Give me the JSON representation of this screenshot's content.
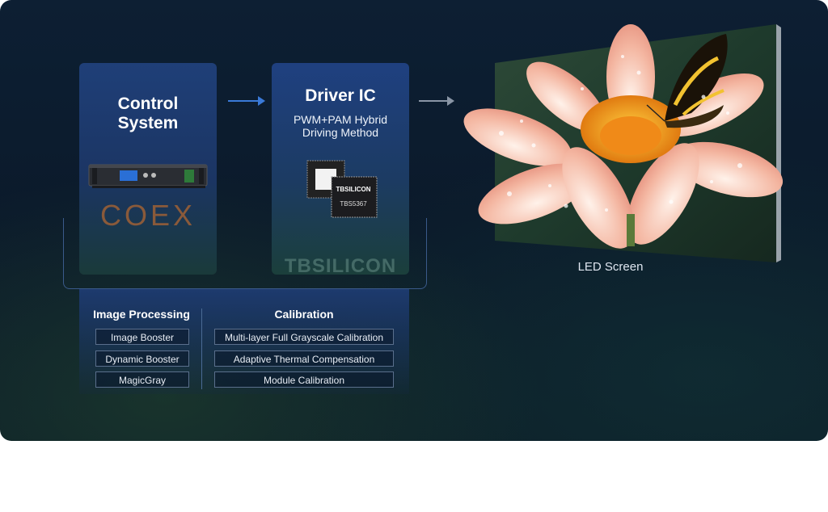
{
  "control": {
    "title_line1": "Control",
    "title_line2": "System",
    "brand": "COEX"
  },
  "driver": {
    "title": "Driver IC",
    "sub_line1": "PWM+PAM Hybrid",
    "sub_line2": "Driving Method",
    "chip_brand": "TBSILICON",
    "chip_model": "TBS5367",
    "watermark": "TBSILICON"
  },
  "image_processing": {
    "title": "Image Processing",
    "items": [
      "Image Booster",
      "Dynamic Booster",
      "MagicGray"
    ]
  },
  "calibration": {
    "title": "Calibration",
    "items": [
      "Multi-layer Full Grayscale Calibration",
      "Adaptive Thermal Compensation",
      "Module Calibration"
    ]
  },
  "led": {
    "label": "LED Screen"
  },
  "colors": {
    "arrow_blue": "#3a7ad8",
    "arrow_gray": "#8a96a6",
    "coex_brown": "#8a5a3a"
  }
}
